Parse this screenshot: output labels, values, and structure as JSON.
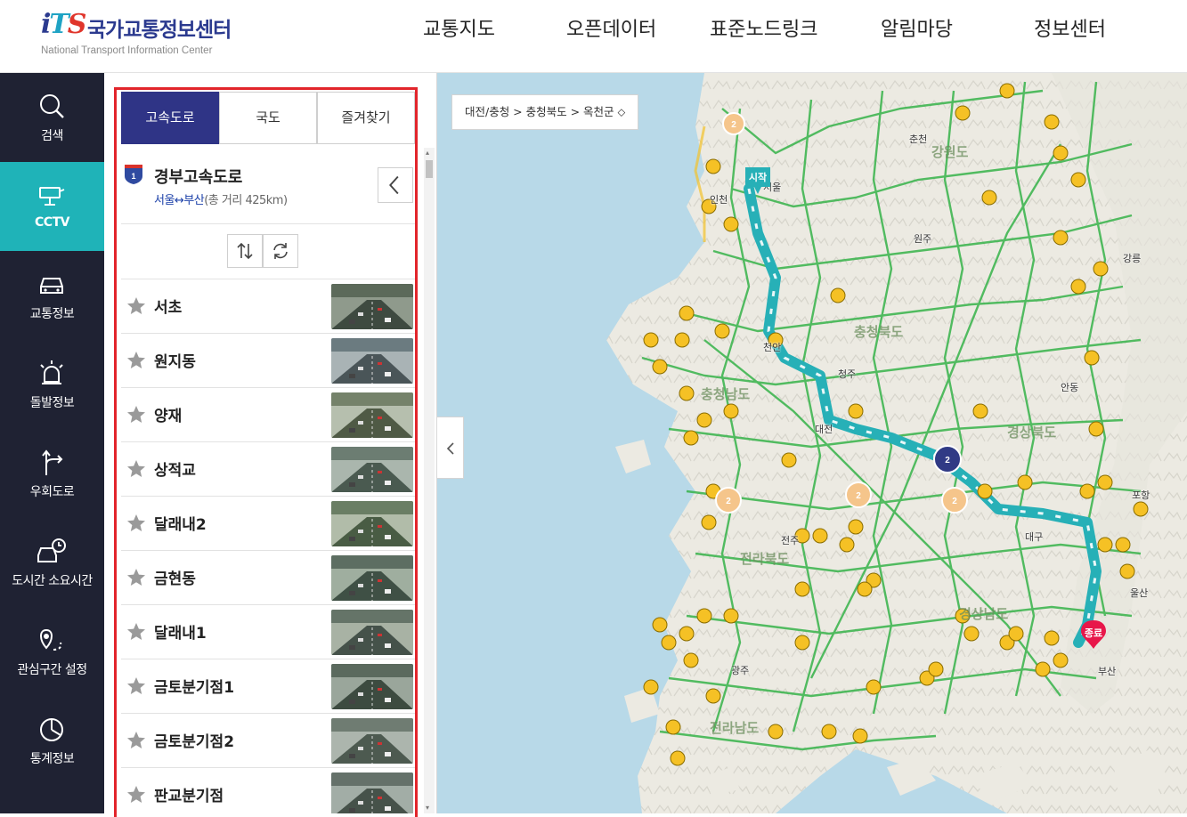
{
  "header": {
    "logo_mark": "iTS",
    "logo_title": "국가교통정보센터",
    "logo_sub": "National Transport Information Center",
    "nav": [
      "교통지도",
      "오픈데이터",
      "표준노드링크",
      "알림마당",
      "정보센터"
    ]
  },
  "sidebar": {
    "items": [
      {
        "label": "검색",
        "icon": "search-icon"
      },
      {
        "label": "CCTV",
        "icon": "cctv-icon"
      },
      {
        "label": "교통정보",
        "icon": "car-icon"
      },
      {
        "label": "돌발정보",
        "icon": "siren-icon"
      },
      {
        "label": "우회도로",
        "icon": "detour-icon"
      },
      {
        "label": "도시간 소요시간",
        "icon": "car-clock-icon"
      },
      {
        "label": "관심구간 설정",
        "icon": "route-pin-icon"
      },
      {
        "label": "통계정보",
        "icon": "chart-icon"
      }
    ],
    "active_index": 1
  },
  "panel": {
    "tabs": [
      "고속도로",
      "국도",
      "즐겨찾기"
    ],
    "active_tab": 0,
    "road": {
      "number": "1",
      "name": "경부고속도로",
      "range": "서울↔부산",
      "distance": "(총 거리 425km)"
    },
    "cctv": [
      {
        "name": "서초"
      },
      {
        "name": "원지동"
      },
      {
        "name": "양재"
      },
      {
        "name": "상적교"
      },
      {
        "name": "달래내2"
      },
      {
        "name": "금현동"
      },
      {
        "name": "달래내1"
      },
      {
        "name": "금토분기점1"
      },
      {
        "name": "금토분기점2"
      },
      {
        "name": "판교분기점"
      }
    ]
  },
  "map": {
    "breadcrumb": "대전/충청 > 충청북도 > 옥천군 ⬦",
    "start_label": "시작",
    "end_label": "종료",
    "cluster_counts": [
      "2",
      "2",
      "2",
      "2",
      "2"
    ],
    "regions": [
      "강원도",
      "충청북도",
      "충청남도",
      "경상북도",
      "전라북도",
      "경상남도",
      "전라남도"
    ],
    "cities": [
      "서울",
      "인천",
      "춘천",
      "강릉",
      "원주",
      "청주",
      "대전",
      "대구",
      "울산",
      "부산",
      "광주",
      "전주",
      "포항",
      "안동",
      "천안"
    ],
    "colors": {
      "road": "#37b34a",
      "route": "#27b0b7",
      "highway": "#f3c22b",
      "sea": "#b8d9e8",
      "land": "#eeede6"
    }
  }
}
